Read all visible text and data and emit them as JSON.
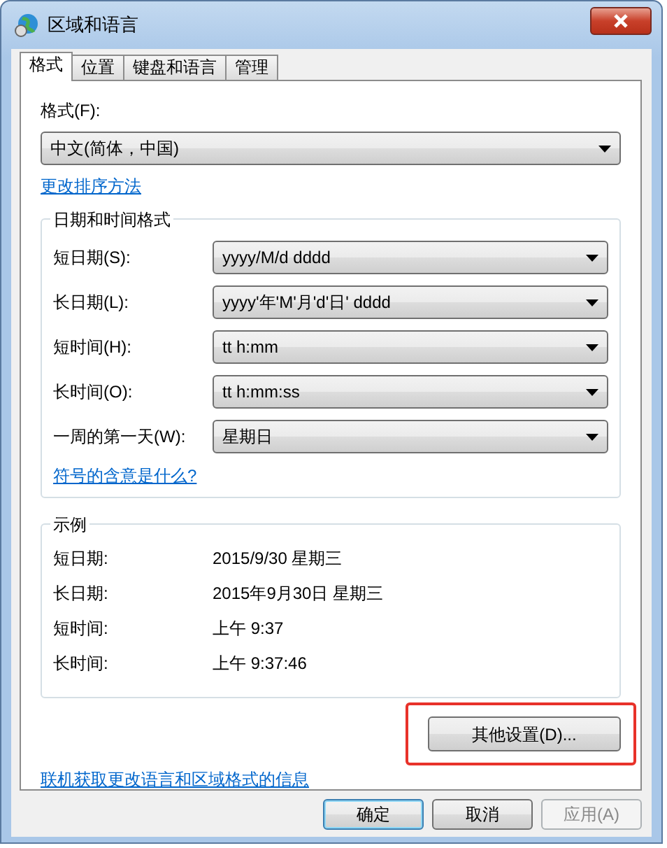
{
  "window": {
    "title": "区域和语言"
  },
  "tabs": [
    {
      "label": "格式",
      "selected": true
    },
    {
      "label": "位置",
      "selected": false
    },
    {
      "label": "键盘和语言",
      "selected": false
    },
    {
      "label": "管理",
      "selected": false
    }
  ],
  "format": {
    "label": "格式(F):",
    "value": "中文(简体，中国)"
  },
  "sort_link": "更改排序方法",
  "date_time_group": {
    "title": "日期和时间格式",
    "rows": [
      {
        "label": "短日期(S):",
        "value": "yyyy/M/d dddd"
      },
      {
        "label": "长日期(L):",
        "value": "yyyy'年'M'月'd'日' dddd"
      },
      {
        "label": "短时间(H):",
        "value": "tt h:mm"
      },
      {
        "label": "长时间(O):",
        "value": "tt h:mm:ss"
      },
      {
        "label": "一周的第一天(W):",
        "value": "星期日"
      }
    ],
    "link": "符号的含意是什么?"
  },
  "example_group": {
    "title": "示例",
    "rows": [
      {
        "label": "短日期:",
        "value": "2015/9/30 星期三"
      },
      {
        "label": "长日期:",
        "value": "2015年9月30日 星期三"
      },
      {
        "label": "短时间:",
        "value": "上午 9:37"
      },
      {
        "label": "长时间:",
        "value": "上午 9:37:46"
      }
    ]
  },
  "other_settings_button": {
    "label": "其他设置(D)...",
    "highlighted": true
  },
  "online_link": "联机获取更改语言和区域格式的信息",
  "buttons": [
    {
      "label": "确定",
      "disabled": false,
      "default": true
    },
    {
      "label": "取消",
      "disabled": false,
      "default": false
    },
    {
      "label": "应用(A)",
      "disabled": true,
      "default": false
    }
  ]
}
